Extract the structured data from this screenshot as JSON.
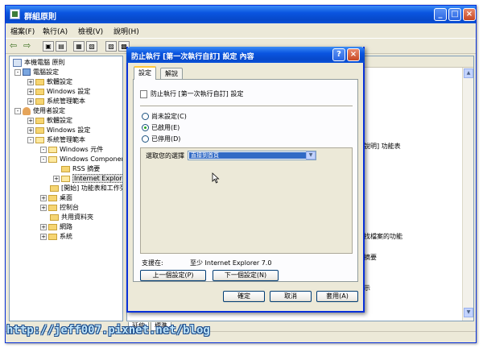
{
  "window": {
    "title": "群組原則",
    "minimize": "_",
    "maximize": "□",
    "close": "×"
  },
  "menu": [
    "檔案(F)",
    "執行(A)",
    "檢視(V)",
    "說明(H)"
  ],
  "toolbar": {
    "back": "⇦",
    "forward": "⇨",
    "buttons": [
      "▣",
      "▤",
      "▦",
      "▧",
      "▨",
      "▩"
    ]
  },
  "tree": {
    "items": [
      {
        "label": "本機電腦 原則",
        "icon": "policy-icon",
        "expander": ""
      },
      {
        "label": "電腦設定",
        "icon": "pc-icon",
        "expander": "-"
      },
      {
        "label": "軟體設定",
        "icon": "folder-icon",
        "expander": "+"
      },
      {
        "label": "Windows 設定",
        "icon": "folder-icon",
        "expander": "+"
      },
      {
        "label": "系統管理範本",
        "icon": "folder-icon",
        "expander": "+"
      },
      {
        "label": "使用者設定",
        "icon": "user-icon",
        "expander": "-"
      },
      {
        "label": "軟體設定",
        "icon": "folder-icon",
        "expander": "+"
      },
      {
        "label": "Windows 設定",
        "icon": "folder-icon",
        "expander": "+"
      },
      {
        "label": "系統管理範本",
        "icon": "folder-icon",
        "expander": "-"
      },
      {
        "label": "Windows 元件",
        "icon": "folder-icon",
        "expander": "-"
      },
      {
        "label": "Windows Components",
        "icon": "folder-icon",
        "expander": "-"
      },
      {
        "label": "RSS 摘要",
        "icon": "folder-icon",
        "expander": ""
      },
      {
        "label": "Internet Explorer",
        "icon": "folder-icon",
        "expander": "+"
      },
      {
        "label": "[開始] 功能表和工作列",
        "icon": "folder-icon",
        "expander": ""
      },
      {
        "label": "桌面",
        "icon": "folder-icon",
        "expander": "+"
      },
      {
        "label": "控制台",
        "icon": "folder-icon",
        "expander": "+"
      },
      {
        "label": "共用資料夾",
        "icon": "folder-icon",
        "expander": ""
      },
      {
        "label": "網路",
        "icon": "folder-icon",
        "expander": "+"
      },
      {
        "label": "系統",
        "icon": "folder-icon",
        "expander": "+"
      }
    ]
  },
  "right_pane": {
    "texts": [
      "說明] 功能表",
      "找檔案的功能",
      "摘要",
      "示"
    ]
  },
  "bottom_tabs": [
    "延伸",
    "標準"
  ],
  "dialog": {
    "title": "防止執行 [第一次執行自訂] 設定 內容",
    "help": "?",
    "close": "×",
    "tabs": [
      "設定",
      "解說"
    ],
    "policy_name": "防止執行 [第一次執行自訂] 設定",
    "options": [
      {
        "label": "尚未設定(C)",
        "checked": false
      },
      {
        "label": "已啟用(E)",
        "checked": true
      },
      {
        "label": "已停用(D)",
        "checked": false
      }
    ],
    "choose_label": "選取您的選擇",
    "choose_value": "直接到首頁",
    "support_label": "支援在:",
    "support_value": "至少 Internet Explorer 7.0",
    "prev_button": "上一個設定(P)",
    "next_button": "下一個設定(N)",
    "ok_button": "確定",
    "cancel_button": "取消",
    "apply_button": "套用(A)"
  },
  "watermark": "http://jeff007.pixnet.net/blog"
}
